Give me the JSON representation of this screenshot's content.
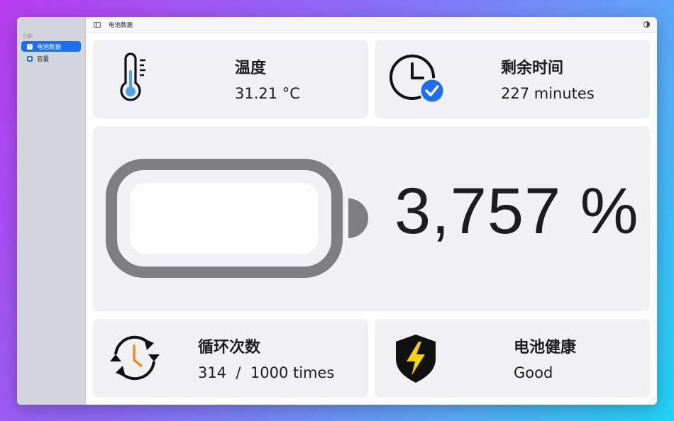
{
  "sidebar": {
    "section": "功能",
    "items": [
      {
        "label": "电池数据",
        "icon": "bolt-icon",
        "active": true
      },
      {
        "label": "容量",
        "icon": "capacity-icon",
        "active": false
      }
    ]
  },
  "toolbar": {
    "title": "电池数据"
  },
  "cards": {
    "temperature": {
      "title": "温度",
      "value": "31.21 °C"
    },
    "remaining": {
      "title": "剩余时间",
      "value": "227 minutes"
    },
    "battery": {
      "percent": "3,757 %"
    },
    "cycles": {
      "title": "循环次数",
      "value": "314  /  1000 times"
    },
    "health": {
      "title": "电池健康",
      "value": "Good"
    }
  },
  "colors": {
    "accent": "#1d6ff2",
    "bolt": "#f5d20a",
    "thermo": "#4aa6e8",
    "clock_hand": "#f08a1d"
  }
}
